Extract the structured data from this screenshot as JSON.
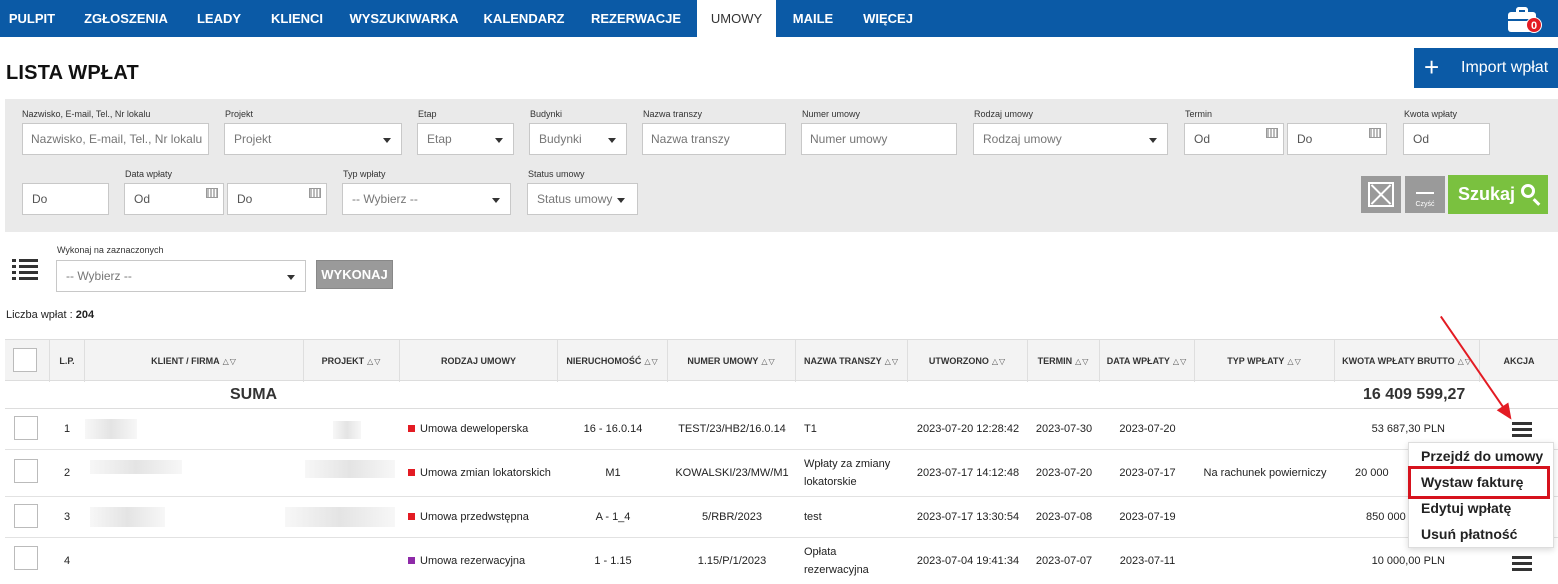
{
  "nav": {
    "tabs": [
      "PULPIT",
      "ZGŁOSZENIA",
      "LEADY",
      "KLIENCI",
      "WYSZUKIWARKA",
      "KALENDARZ",
      "REZERWACJE",
      "UMOWY",
      "MAILE",
      "WIĘCEJ"
    ],
    "active": "UMOWY",
    "badge_count": "0"
  },
  "page": {
    "title": "LISTA WPŁAT",
    "import_button": "Import wpłat",
    "accent": "#0b5aa6"
  },
  "filters": {
    "search": {
      "label": "Nazwisko, E-mail, Tel., Nr lokalu",
      "placeholder": "Nazwisko, E-mail, Tel., Nr lokalu"
    },
    "projekt": {
      "label": "Projekt",
      "value": "Projekt"
    },
    "etap": {
      "label": "Etap",
      "value": "Etap"
    },
    "budynki": {
      "label": "Budynki",
      "value": "Budynki"
    },
    "nazwa_transzy": {
      "label": "Nazwa transzy",
      "placeholder": "Nazwa transzy"
    },
    "numer_umowy": {
      "label": "Numer umowy",
      "placeholder": "Numer umowy"
    },
    "rodzaj_umowy": {
      "label": "Rodzaj umowy",
      "value": "Rodzaj umowy"
    },
    "termin": {
      "label": "Termin",
      "from": "Od",
      "to": "Do"
    },
    "kwota_wplaty": {
      "label": "Kwota wpłaty",
      "from": "Od",
      "to": "Do"
    },
    "data_wplaty": {
      "label": "Data wpłaty",
      "from": "Od",
      "to": "Do"
    },
    "typ_wplaty": {
      "label": "Typ wpłaty",
      "value": "-- Wybierz --"
    },
    "status_umowy": {
      "label": "Status umowy",
      "value": "Status umowy"
    },
    "clear_label": "Czyść",
    "search_button": "Szukaj"
  },
  "bulk": {
    "label": "Wykonaj na zaznaczonych",
    "select_value": "-- Wybierz --",
    "execute_button": "WYKONAJ"
  },
  "count": {
    "label": "Liczba wpłat :",
    "value": "204"
  },
  "table": {
    "columns": [
      "L.P.",
      "KLIENT / FIRMA",
      "PROJEKT",
      "RODZAJ UMOWY",
      "NIERUCHOMOŚĆ",
      "NUMER UMOWY",
      "NAZWA TRANSZY",
      "UTWORZONO",
      "TERMIN",
      "DATA WPŁATY",
      "TYP WPŁATY",
      "KWOTA WPŁATY BRUTTO",
      "AKCJA"
    ],
    "sum_label": "SUMA",
    "sum_value": "16 409 599,27",
    "rows": [
      {
        "lp": "1",
        "rodzaj": "Umowa deweloperska",
        "rodzaj_color": "#e31b23",
        "nieruchomosc": "16 - 16.0.14",
        "numer": "TEST/23/HB2/16.0.14",
        "transza": "T1",
        "utworzono": "2023-07-20 12:28:42",
        "termin": "2023-07-30",
        "data_wplaty": "2023-07-20",
        "typ": "",
        "kwota": "53 687,30 PLN"
      },
      {
        "lp": "2",
        "rodzaj": "Umowa zmian lokatorskich",
        "rodzaj_color": "#e31b23",
        "nieruchomosc": "M1",
        "numer": "KOWALSKI/23/MW/M1",
        "transza": "Wpłaty za zmiany lokatorskie",
        "utworzono": "2023-07-17 14:12:48",
        "termin": "2023-07-20",
        "data_wplaty": "2023-07-17",
        "typ": "Na rachunek powierniczy",
        "kwota": "20 000"
      },
      {
        "lp": "3",
        "rodzaj": "Umowa przedwstępna",
        "rodzaj_color": "#e31b23",
        "nieruchomosc": "A - 1_4",
        "numer": "5/RBR/2023",
        "transza": "test",
        "utworzono": "2023-07-17 13:30:54",
        "termin": "2023-07-08",
        "data_wplaty": "2023-07-19",
        "typ": "",
        "kwota": "850 000"
      },
      {
        "lp": "4",
        "rodzaj": "Umowa rezerwacyjna",
        "rodzaj_color": "#8e2aa8",
        "nieruchomosc": "1 - 1.15",
        "numer": "1.15/P/1/2023",
        "transza": "Opłata rezerwacyjna",
        "utworzono": "2023-07-04 19:41:34",
        "termin": "2023-07-07",
        "data_wplaty": "2023-07-11",
        "typ": "",
        "kwota": "10 000,00 PLN"
      }
    ]
  },
  "action_menu": {
    "items": [
      "Przejdź do umowy",
      "Wystaw fakturę",
      "Edytuj wpłatę",
      "Usuń płatność"
    ],
    "highlighted": "Wystaw fakturę",
    "highlight_color": "#d6121d"
  }
}
